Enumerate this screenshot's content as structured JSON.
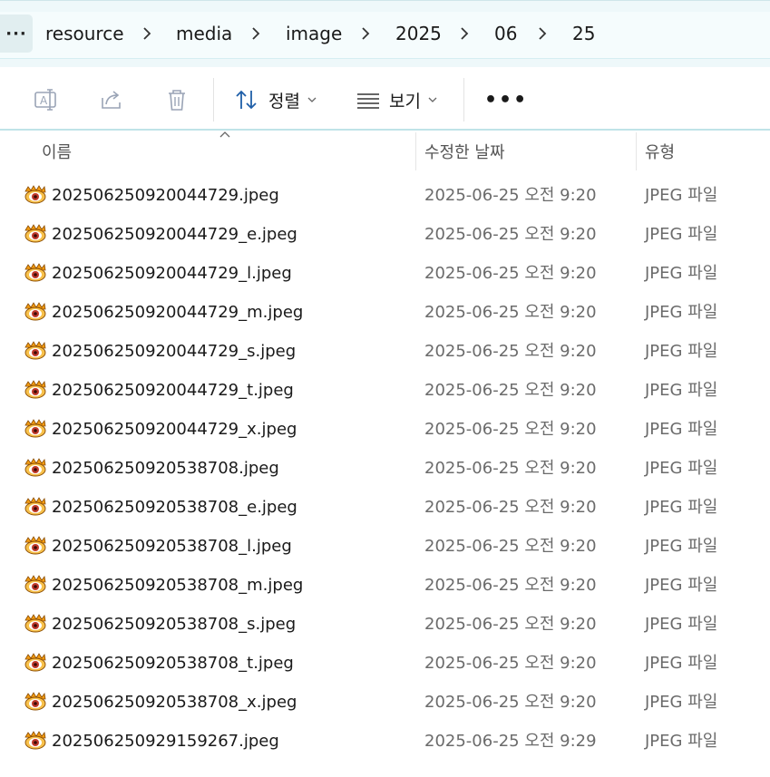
{
  "breadcrumb": {
    "overflow_label": "···",
    "items": [
      "resource",
      "media",
      "image",
      "2025",
      "06",
      "25"
    ]
  },
  "toolbar": {
    "rename_icon": "rename-icon",
    "share_icon": "share-icon",
    "delete_icon": "delete-icon",
    "sort_label": "정렬",
    "view_label": "보기",
    "more_label": "•••"
  },
  "columns": {
    "name": "이름",
    "date": "수정한 날짜",
    "type": "유형"
  },
  "files": [
    {
      "name": "20250625092004472​9.jpeg",
      "date": "2025-06-25 오전 9:20",
      "type": "JPEG 파일"
    },
    {
      "name": "202506250920044729_e.jpeg",
      "date": "2025-06-25 오전 9:20",
      "type": "JPEG 파일"
    },
    {
      "name": "202506250920044729_l.jpeg",
      "date": "2025-06-25 오전 9:20",
      "type": "JPEG 파일"
    },
    {
      "name": "202506250920044729_m.jpeg",
      "date": "2025-06-25 오전 9:20",
      "type": "JPEG 파일"
    },
    {
      "name": "202506250920044729_s.jpeg",
      "date": "2025-06-25 오전 9:20",
      "type": "JPEG 파일"
    },
    {
      "name": "202506250920044729_t.jpeg",
      "date": "2025-06-25 오전 9:20",
      "type": "JPEG 파일"
    },
    {
      "name": "202506250920044729_x.jpeg",
      "date": "2025-06-25 오전 9:20",
      "type": "JPEG 파일"
    },
    {
      "name": "202506250920538708.jpeg",
      "date": "2025-06-25 오전 9:20",
      "type": "JPEG 파일"
    },
    {
      "name": "202506250920538708_e.jpeg",
      "date": "2025-06-25 오전 9:20",
      "type": "JPEG 파일"
    },
    {
      "name": "202506250920538708_l.jpeg",
      "date": "2025-06-25 오전 9:20",
      "type": "JPEG 파일"
    },
    {
      "name": "202506250920538708_m.jpeg",
      "date": "2025-06-25 오전 9:20",
      "type": "JPEG 파일"
    },
    {
      "name": "202506250920538708_s.jpeg",
      "date": "2025-06-25 오전 9:20",
      "type": "JPEG 파일"
    },
    {
      "name": "202506250920538708_t.jpeg",
      "date": "2025-06-25 오전 9:20",
      "type": "JPEG 파일"
    },
    {
      "name": "202506250920538708_x.jpeg",
      "date": "2025-06-25 오전 9:20",
      "type": "JPEG 파일"
    },
    {
      "name": "202506250929159267.jpeg",
      "date": "2025-06-25 오전 9:29",
      "type": "JPEG 파일"
    }
  ],
  "colors": {
    "address_bg": "#eef8fa",
    "toolbar_border": "#bfe3e8",
    "icon_disabled": "#9aa4b6",
    "file_icon_orange": "#f39c12",
    "file_icon_red": "#c0392b"
  }
}
